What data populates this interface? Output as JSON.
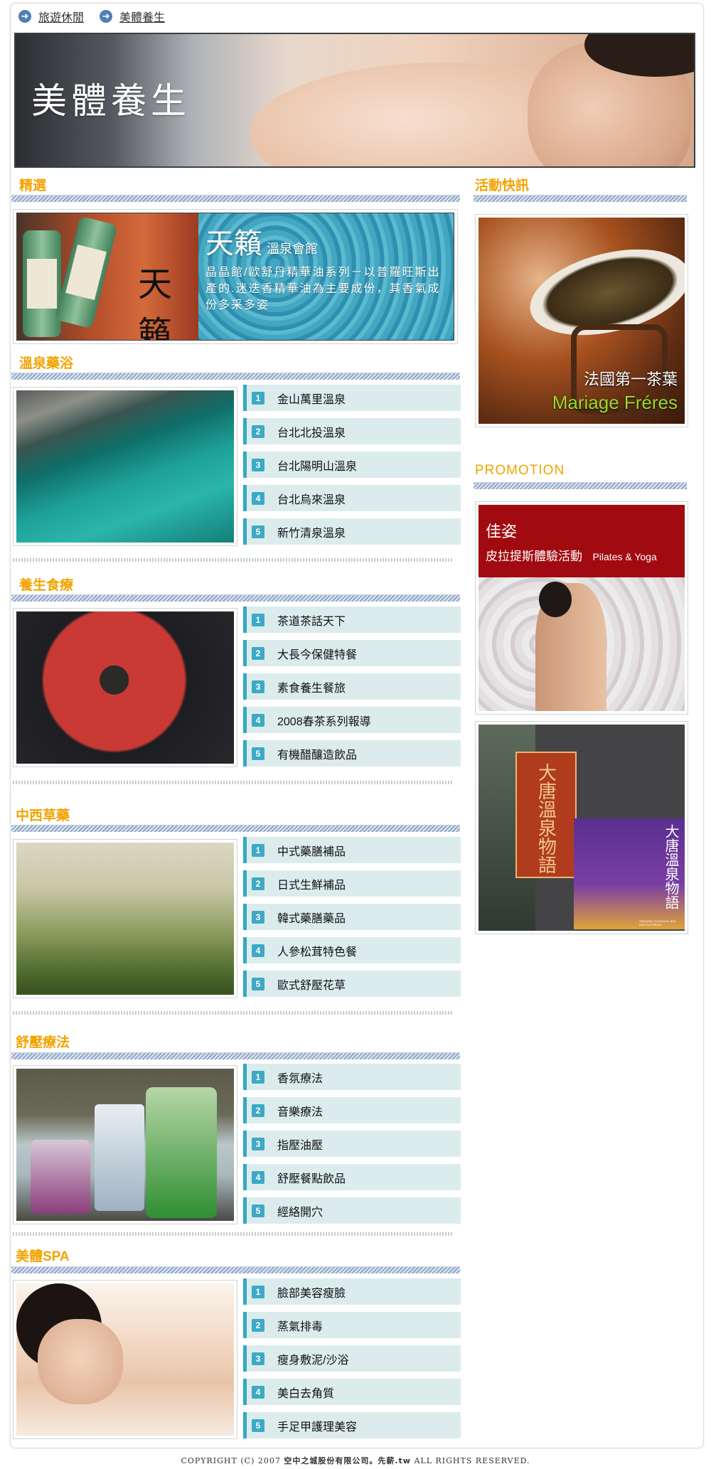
{
  "breadcrumb": [
    {
      "label": "旅遊休閒"
    },
    {
      "label": "美體養生"
    }
  ],
  "banner": {
    "title": "美體養生"
  },
  "featured": {
    "heading": "精選",
    "brand": "天籟",
    "brand_sub": "溫泉會館",
    "description": "晶晶館/歐舒丹精華油系列－以普羅旺斯出產的.迷迭香精華油為主要成份，其香氣成份多采多姿"
  },
  "sections": [
    {
      "heading": "溫泉藥浴",
      "items": [
        "金山萬里溫泉",
        "台北北投溫泉",
        "台北陽明山溫泉",
        "台北烏來溫泉",
        "新竹清泉溫泉"
      ]
    },
    {
      "heading": "養生食療",
      "items": [
        "茶道茶話天下",
        "大長今保健特餐",
        "素食養生餐旅",
        "2008春茶系列報導",
        "有機醋釀造飲品"
      ]
    },
    {
      "heading": "中西草藥",
      "items": [
        "中式藥膳補品",
        "日式生鮮補品",
        "韓式藥膳藥品",
        "人參松茸特色餐",
        "歐式舒壓花草"
      ]
    },
    {
      "heading": "舒壓療法",
      "items": [
        "香氛療法",
        "音樂療法",
        "指壓油壓",
        "舒壓餐點飲品",
        "經絡開穴"
      ]
    },
    {
      "heading": "美體SPA",
      "items": [
        "臉部美容瘦臉",
        "蒸氣排毒",
        "瘦身敷泥/沙浴",
        "美白去角質",
        "手足甲護理美容"
      ]
    }
  ],
  "numbers": [
    "1",
    "2",
    "3",
    "4",
    "5"
  ],
  "right": {
    "news_heading": "活動快訊",
    "tea_caption_1": "法國第一茶葉",
    "tea_caption_2": "Mariage Fréres",
    "promo_heading": "PROMOTION",
    "promo_title": "佳姿",
    "promo_sub": "皮拉提斯體驗活動",
    "promo_en": "Pilates & Yoga",
    "book_title": "大唐溫泉物語",
    "book_en": "ORIENTAL CLASSICAL SPA ENCYCLOPEDIA"
  },
  "footer": {
    "pre": "COPYRIGHT (C) 2007 ",
    "company": "空中之城股份有限公司",
    "brand": "。先薪.tw",
    "post": " ALL RIGHTS RESERVED."
  },
  "colors": {
    "accent": "#f2a300",
    "item_bg": "#dceced",
    "item_bar": "#33a9c0"
  }
}
